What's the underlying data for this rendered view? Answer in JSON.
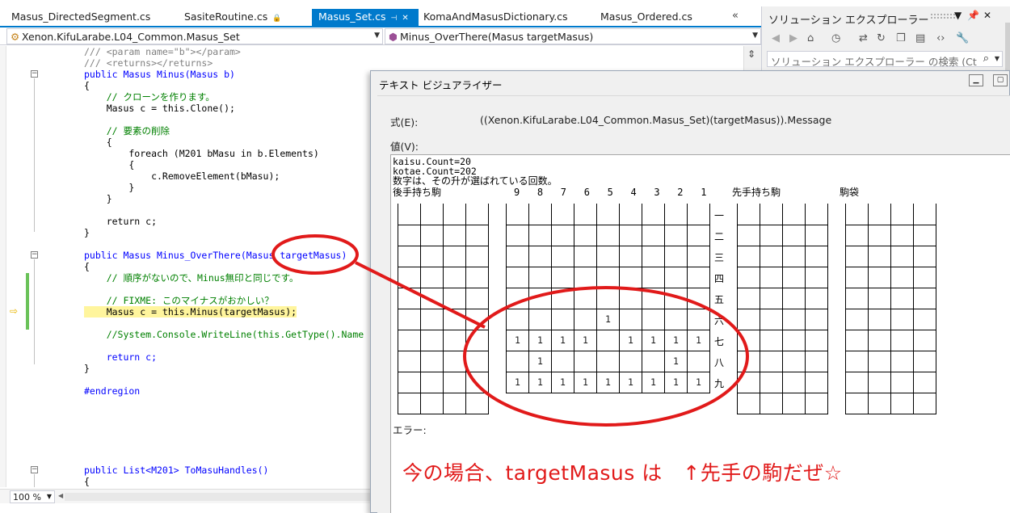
{
  "tabs": [
    {
      "label": "Masus_DirectedSegment.cs",
      "active": false
    },
    {
      "label": "SasiteRoutine.cs",
      "active": false
    },
    {
      "label": "Masus_Set.cs",
      "active": true
    },
    {
      "label": "KomaAndMasusDictionary.cs",
      "active": false
    },
    {
      "label": "Masus_Ordered.cs",
      "active": false
    }
  ],
  "tab_scroll_glyph": "«",
  "nav": {
    "class_dropdown": "Xenon.KifuLarabe.L04_Common.Masus_Set",
    "member_dropdown": "Minus_OverThere(Masus targetMasus)"
  },
  "code_lines": [
    "/// <param name=\"b\"></param>",
    "/// <returns></returns>",
    "public Masus Minus(Masus b)",
    "{",
    "    // クローンを作ります。",
    "    Masus c = this.Clone();",
    "",
    "    // 要素の削除",
    "    {",
    "        foreach (M201 bMasu in b.Elements)",
    "        {",
    "            c.RemoveElement(bMasu);",
    "        }",
    "    }",
    "",
    "    return c;",
    "}",
    "",
    "public Masus Minus_OverThere(Masus targetMasus)",
    "{",
    "    // 順序がないので、Minus無印と同じです。",
    "",
    "    // FIXME: このマイナスがおかしい？",
    "    Masus c = this.Minus(targetMasus);",
    "",
    "    //System.Console.WriteLine(this.GetType().Name",
    "",
    "    return c;",
    "}",
    "",
    "#endregion",
    "",
    "",
    "",
    "",
    "",
    "public List<M201> ToMasuHandles()",
    "{"
  ],
  "status": {
    "zoom": "100 %"
  },
  "solution_explorer": {
    "title": "ソリューション エクスプローラー",
    "search_placeholder": "ソリューション エクスプローラー の検索 (Ct"
  },
  "dialog": {
    "title": "テキスト ビジュアライザー",
    "expression_label": "式(E):",
    "expression_value": "((Xenon.KifuLarabe.L04_Common.Masus_Set)(targetMasus)).Message",
    "value_label": "値(V):",
    "value_lines": [
      "kaisu.Count=20",
      "kotae.Count=202",
      "数字は、その升が選ばれている回数。"
    ],
    "header_gote": "後手持ち駒",
    "header_cols": "9   8   7   6   5   4   3   2   1",
    "header_sente": "先手持ち駒",
    "header_komabukuro": "駒袋",
    "row_labels": [
      "一",
      "二",
      "三",
      "四",
      "五",
      "六",
      "七",
      "八",
      "九"
    ],
    "board": [
      [
        "",
        "",
        "",
        "",
        "",
        "",
        "",
        "",
        ""
      ],
      [
        "",
        "",
        "",
        "",
        "",
        "",
        "",
        "",
        ""
      ],
      [
        "",
        "",
        "",
        "",
        "",
        "",
        "",
        "",
        ""
      ],
      [
        "",
        "",
        "",
        "",
        "",
        "",
        "",
        "",
        ""
      ],
      [
        "",
        "",
        "",
        "",
        "",
        "",
        "",
        "",
        ""
      ],
      [
        "",
        "",
        "",
        "",
        "1",
        "",
        "",
        "",
        ""
      ],
      [
        "1",
        "1",
        "1",
        "1",
        "",
        "1",
        "1",
        "1",
        "1"
      ],
      [
        "",
        "1",
        "",
        "",
        "",
        "",
        "",
        "1",
        ""
      ],
      [
        "1",
        "1",
        "1",
        "1",
        "1",
        "1",
        "1",
        "1",
        "1"
      ]
    ],
    "error_label": "エラー:"
  },
  "annotation": {
    "text": "今の場合、targetMasus は　↑先手の駒だぜ☆",
    "color": "#e11a1a"
  }
}
